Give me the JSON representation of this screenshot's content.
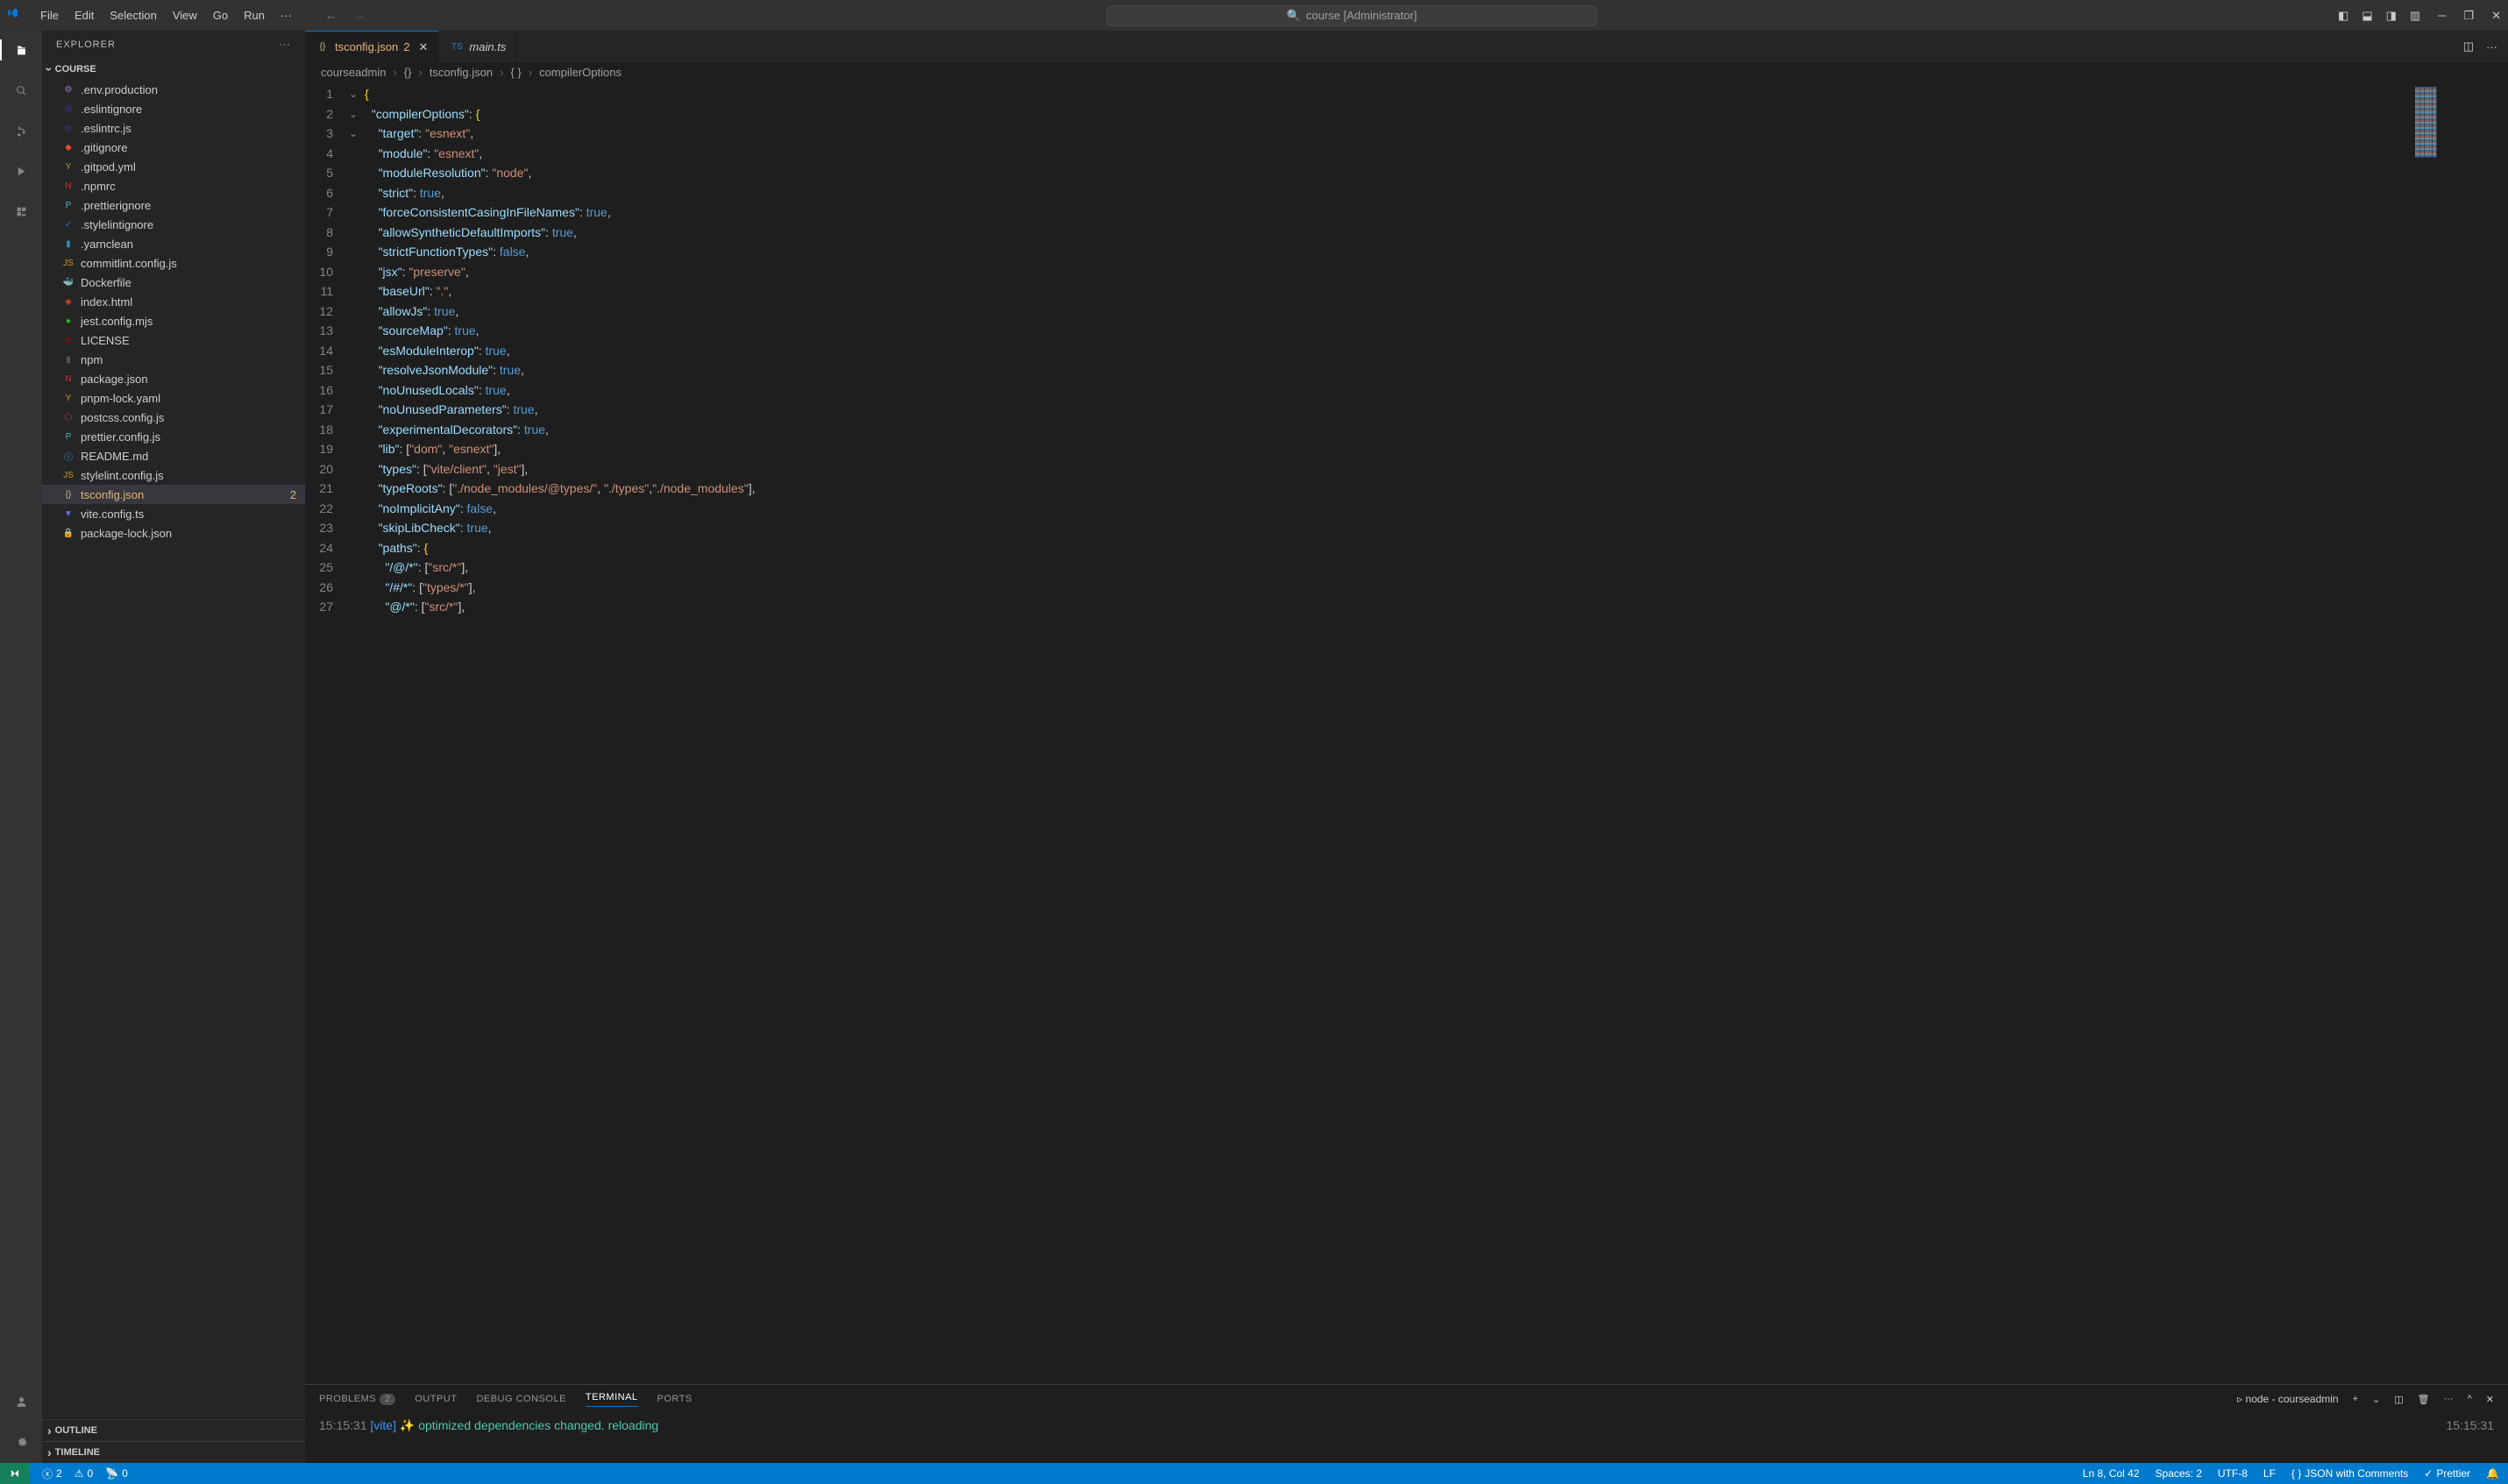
{
  "titlebar": {
    "menu": [
      "File",
      "Edit",
      "Selection",
      "View",
      "Go",
      "Run",
      "···"
    ],
    "search": "course [Administrator]"
  },
  "sidebar": {
    "title": "EXPLORER",
    "section": "COURSE",
    "files": [
      {
        "icon": "⚙",
        "name": ".env.production",
        "color": "#a074c4"
      },
      {
        "icon": "◎",
        "name": ".eslintignore",
        "color": "#4b32c3"
      },
      {
        "icon": "◎",
        "name": ".eslintrc.js",
        "color": "#4b32c3"
      },
      {
        "icon": "◆",
        "name": ".gitignore",
        "color": "#e44d26"
      },
      {
        "icon": "Y",
        "name": ".gitpod.yml",
        "color": "#cb9834"
      },
      {
        "icon": "N",
        "name": ".npmrc",
        "color": "#cb3837"
      },
      {
        "icon": "P",
        "name": ".prettierignore",
        "color": "#56b3b4"
      },
      {
        "icon": "✓",
        "name": ".stylelintignore",
        "color": "#3578e5"
      },
      {
        "icon": "▮",
        "name": ".yarnclean",
        "color": "#2c8ebb"
      },
      {
        "icon": "JS",
        "name": "commitlint.config.js",
        "color": "#cb9834"
      },
      {
        "icon": "🐳",
        "name": "Dockerfile",
        "color": "#0db7ed"
      },
      {
        "icon": "◈",
        "name": "index.html",
        "color": "#e44d26"
      },
      {
        "icon": "●",
        "name": "jest.config.mjs",
        "color": "#15c213"
      },
      {
        "icon": "©",
        "name": "LICENSE",
        "color": "#cc0000"
      },
      {
        "icon": "▮",
        "name": "npm",
        "color": "#4d5a5e"
      },
      {
        "icon": "N",
        "name": "package.json",
        "color": "#cb3837"
      },
      {
        "icon": "Y",
        "name": "pnpm-lock.yaml",
        "color": "#cb9834"
      },
      {
        "icon": "⬡",
        "name": "postcss.config.js",
        "color": "#cc3534"
      },
      {
        "icon": "P",
        "name": "prettier.config.js",
        "color": "#56b3b4"
      },
      {
        "icon": "ⓘ",
        "name": "README.md",
        "color": "#42a5f5"
      },
      {
        "icon": "JS",
        "name": "stylelint.config.js",
        "color": "#cb9834"
      },
      {
        "icon": "{}",
        "name": "tsconfig.json",
        "color": "#e2b47e",
        "selected": true,
        "badge": "2"
      },
      {
        "icon": "▼",
        "name": "vite.config.ts",
        "color": "#646cff"
      },
      {
        "icon": "🔒",
        "name": "package-lock.json",
        "color": "#cb3837"
      }
    ],
    "footer": [
      "OUTLINE",
      "TIMELINE"
    ]
  },
  "tabs": [
    {
      "icon": "{}",
      "label": "tsconfig.json",
      "badge": "2",
      "active": true,
      "color": "#e2b47e"
    },
    {
      "icon": "TS",
      "label": "main.ts",
      "active": false,
      "color": "#3178c6",
      "italic": true
    }
  ],
  "breadcrumb": [
    "courseadmin",
    "{}",
    "tsconfig.json",
    "{ }",
    "compilerOptions"
  ],
  "code": {
    "lines": [
      [
        {
          "t": "{",
          "c": "brace"
        }
      ],
      [
        {
          "t": "  ",
          "c": "punc"
        },
        {
          "t": "\"compilerOptions\"",
          "c": "key"
        },
        {
          "t": ": ",
          "c": "punc"
        },
        {
          "t": "{",
          "c": "brace"
        }
      ],
      [
        {
          "t": "    ",
          "c": "punc"
        },
        {
          "t": "\"target\"",
          "c": "key"
        },
        {
          "t": ": ",
          "c": "punc"
        },
        {
          "t": "\"esnext\"",
          "c": "str"
        },
        {
          "t": ",",
          "c": "punc"
        }
      ],
      [
        {
          "t": "    ",
          "c": "punc"
        },
        {
          "t": "\"module\"",
          "c": "key"
        },
        {
          "t": ": ",
          "c": "punc"
        },
        {
          "t": "\"esnext\"",
          "c": "str"
        },
        {
          "t": ",",
          "c": "punc"
        }
      ],
      [
        {
          "t": "    ",
          "c": "punc"
        },
        {
          "t": "\"moduleResolution\"",
          "c": "key"
        },
        {
          "t": ": ",
          "c": "punc"
        },
        {
          "t": "\"node\"",
          "c": "str"
        },
        {
          "t": ",",
          "c": "punc"
        }
      ],
      [
        {
          "t": "    ",
          "c": "punc"
        },
        {
          "t": "\"strict\"",
          "c": "key"
        },
        {
          "t": ": ",
          "c": "punc"
        },
        {
          "t": "true",
          "c": "bool"
        },
        {
          "t": ",",
          "c": "punc"
        }
      ],
      [
        {
          "t": "    ",
          "c": "punc"
        },
        {
          "t": "\"forceConsistentCasingInFileNames\"",
          "c": "key"
        },
        {
          "t": ": ",
          "c": "punc"
        },
        {
          "t": "true",
          "c": "bool"
        },
        {
          "t": ",",
          "c": "punc"
        }
      ],
      [
        {
          "t": "    ",
          "c": "punc"
        },
        {
          "t": "\"allowSyntheticDefaultImports\"",
          "c": "key"
        },
        {
          "t": ": ",
          "c": "punc"
        },
        {
          "t": "true",
          "c": "bool"
        },
        {
          "t": ",",
          "c": "punc"
        }
      ],
      [
        {
          "t": "    ",
          "c": "punc"
        },
        {
          "t": "\"strictFunctionTypes\"",
          "c": "key"
        },
        {
          "t": ": ",
          "c": "punc"
        },
        {
          "t": "false",
          "c": "bool"
        },
        {
          "t": ",",
          "c": "punc"
        }
      ],
      [
        {
          "t": "    ",
          "c": "punc"
        },
        {
          "t": "\"jsx\"",
          "c": "key"
        },
        {
          "t": ": ",
          "c": "punc"
        },
        {
          "t": "\"preserve\"",
          "c": "str"
        },
        {
          "t": ",",
          "c": "punc"
        }
      ],
      [
        {
          "t": "    ",
          "c": "punc"
        },
        {
          "t": "\"baseUrl\"",
          "c": "key"
        },
        {
          "t": ": ",
          "c": "punc"
        },
        {
          "t": "\".\"",
          "c": "str"
        },
        {
          "t": ",",
          "c": "punc"
        }
      ],
      [
        {
          "t": "    ",
          "c": "punc"
        },
        {
          "t": "\"allowJs\"",
          "c": "key"
        },
        {
          "t": ": ",
          "c": "punc"
        },
        {
          "t": "true",
          "c": "bool"
        },
        {
          "t": ",",
          "c": "punc"
        }
      ],
      [
        {
          "t": "    ",
          "c": "punc"
        },
        {
          "t": "\"sourceMap\"",
          "c": "key"
        },
        {
          "t": ": ",
          "c": "punc"
        },
        {
          "t": "true",
          "c": "bool"
        },
        {
          "t": ",",
          "c": "punc"
        }
      ],
      [
        {
          "t": "    ",
          "c": "punc"
        },
        {
          "t": "\"esModuleInterop\"",
          "c": "key"
        },
        {
          "t": ": ",
          "c": "punc"
        },
        {
          "t": "true",
          "c": "bool"
        },
        {
          "t": ",",
          "c": "punc"
        }
      ],
      [
        {
          "t": "    ",
          "c": "punc"
        },
        {
          "t": "\"resolveJsonModule\"",
          "c": "key"
        },
        {
          "t": ": ",
          "c": "punc"
        },
        {
          "t": "true",
          "c": "bool"
        },
        {
          "t": ",",
          "c": "punc"
        }
      ],
      [
        {
          "t": "    ",
          "c": "punc"
        },
        {
          "t": "\"noUnusedLocals\"",
          "c": "key"
        },
        {
          "t": ": ",
          "c": "punc"
        },
        {
          "t": "true",
          "c": "bool"
        },
        {
          "t": ",",
          "c": "punc"
        }
      ],
      [
        {
          "t": "    ",
          "c": "punc"
        },
        {
          "t": "\"noUnusedParameters\"",
          "c": "key"
        },
        {
          "t": ": ",
          "c": "punc"
        },
        {
          "t": "true",
          "c": "bool"
        },
        {
          "t": ",",
          "c": "punc"
        }
      ],
      [
        {
          "t": "    ",
          "c": "punc"
        },
        {
          "t": "\"experimentalDecorators\"",
          "c": "key"
        },
        {
          "t": ": ",
          "c": "punc"
        },
        {
          "t": "true",
          "c": "bool"
        },
        {
          "t": ",",
          "c": "punc"
        }
      ],
      [
        {
          "t": "    ",
          "c": "punc"
        },
        {
          "t": "\"lib\"",
          "c": "key"
        },
        {
          "t": ": [",
          "c": "punc"
        },
        {
          "t": "\"dom\"",
          "c": "str"
        },
        {
          "t": ", ",
          "c": "punc"
        },
        {
          "t": "\"esnext\"",
          "c": "str"
        },
        {
          "t": "],",
          "c": "punc"
        }
      ],
      [
        {
          "t": "    ",
          "c": "punc"
        },
        {
          "t": "\"types\"",
          "c": "key"
        },
        {
          "t": ": [",
          "c": "punc"
        },
        {
          "t": "\"vite/client\"",
          "c": "str"
        },
        {
          "t": ", ",
          "c": "punc"
        },
        {
          "t": "\"jest\"",
          "c": "str"
        },
        {
          "t": "],",
          "c": "punc"
        }
      ],
      [
        {
          "t": "    ",
          "c": "punc"
        },
        {
          "t": "\"typeRoots\"",
          "c": "key"
        },
        {
          "t": ": [",
          "c": "punc"
        },
        {
          "t": "\"./node_modules/@types/\"",
          "c": "str"
        },
        {
          "t": ", ",
          "c": "punc"
        },
        {
          "t": "\"./types\"",
          "c": "str"
        },
        {
          "t": ",",
          "c": "punc"
        },
        {
          "t": "\"./node_modules\"",
          "c": "str"
        },
        {
          "t": "],",
          "c": "punc"
        }
      ],
      [
        {
          "t": "    ",
          "c": "punc"
        },
        {
          "t": "\"noImplicitAny\"",
          "c": "key"
        },
        {
          "t": ": ",
          "c": "punc"
        },
        {
          "t": "false",
          "c": "bool"
        },
        {
          "t": ",",
          "c": "punc"
        }
      ],
      [
        {
          "t": "    ",
          "c": "punc"
        },
        {
          "t": "\"skipLibCheck\"",
          "c": "key"
        },
        {
          "t": ": ",
          "c": "punc"
        },
        {
          "t": "true",
          "c": "bool"
        },
        {
          "t": ",",
          "c": "punc"
        }
      ],
      [
        {
          "t": "    ",
          "c": "punc"
        },
        {
          "t": "\"paths\"",
          "c": "key"
        },
        {
          "t": ": ",
          "c": "punc"
        },
        {
          "t": "{",
          "c": "brace"
        }
      ],
      [
        {
          "t": "      ",
          "c": "punc"
        },
        {
          "t": "\"/@/*\"",
          "c": "key"
        },
        {
          "t": ": [",
          "c": "punc"
        },
        {
          "t": "\"src/*\"",
          "c": "str"
        },
        {
          "t": "],",
          "c": "punc"
        }
      ],
      [
        {
          "t": "      ",
          "c": "punc"
        },
        {
          "t": "\"/#/*\"",
          "c": "key"
        },
        {
          "t": ": [",
          "c": "punc"
        },
        {
          "t": "\"types/*\"",
          "c": "str"
        },
        {
          "t": "],",
          "c": "punc"
        }
      ],
      [
        {
          "t": "      ",
          "c": "punc"
        },
        {
          "t": "\"@/*\"",
          "c": "key"
        },
        {
          "t": ": [",
          "c": "punc"
        },
        {
          "t": "\"src/*\"",
          "c": "str"
        },
        {
          "t": "],",
          "c": "punc"
        }
      ]
    ],
    "fold": {
      "1": "⌄",
      "2": "⌄",
      "24": "⌄"
    }
  },
  "panel": {
    "tabs": [
      {
        "label": "PROBLEMS",
        "count": "2"
      },
      {
        "label": "OUTPUT"
      },
      {
        "label": "DEBUG CONSOLE"
      },
      {
        "label": "TERMINAL",
        "active": true
      },
      {
        "label": "PORTS"
      }
    ],
    "terminal_info": "node - courseadmin",
    "line_time": "15:15:31",
    "line_tag": "[vite]",
    "line_emoji": "✨",
    "line_msg": "optimized dependencies changed. reloading",
    "line_time_right": "15:15:31"
  },
  "status": {
    "errors": "2",
    "warnings": "0",
    "ports": "0",
    "position": "Ln 8, Col 42",
    "spaces": "Spaces: 2",
    "encoding": "UTF-8",
    "eol": "LF",
    "lang": "JSON with Comments",
    "prettier": "Prettier"
  }
}
